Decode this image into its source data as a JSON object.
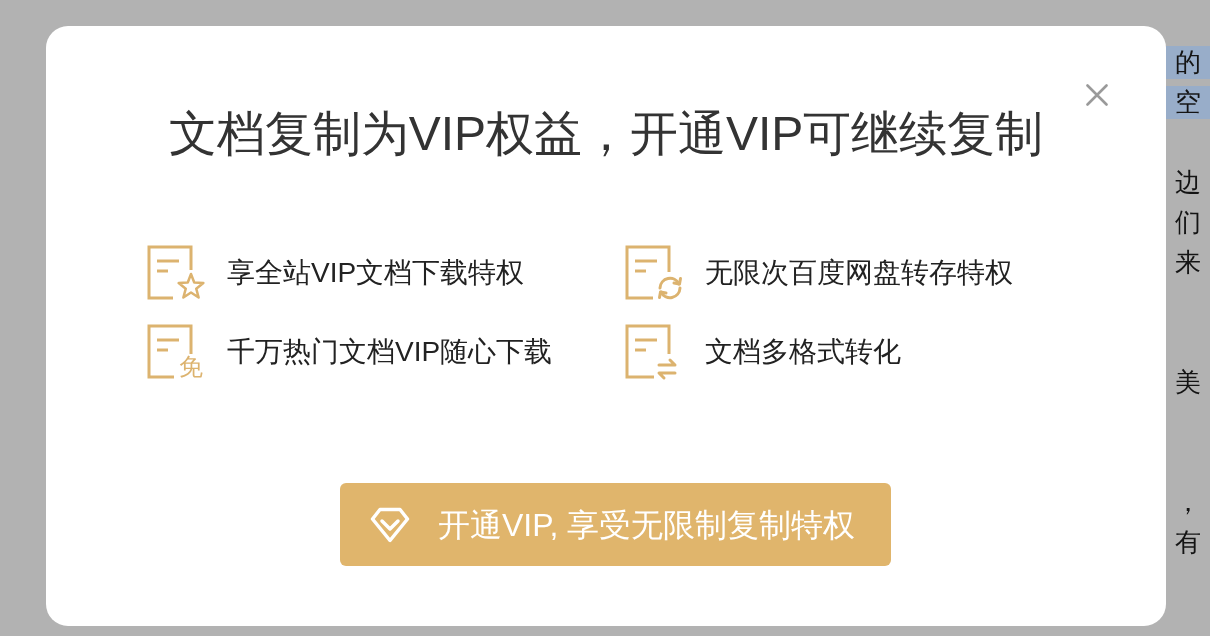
{
  "modal": {
    "title": "文档复制为VIP权益，开通VIP可继续复制",
    "benefits": [
      {
        "kind": "star",
        "label": "享全站VIP文档下载特权"
      },
      {
        "kind": "refresh",
        "label": "无限次百度网盘转存特权"
      },
      {
        "kind": "free",
        "badge": "免",
        "label": "千万热门文档VIP随心下载"
      },
      {
        "kind": "convert",
        "label": "文档多格式转化"
      }
    ],
    "cta_button": {
      "label": "开通VIP, 享受无限制复制特权"
    }
  },
  "background_document": {
    "lines": [
      {
        "text": "的",
        "highlighted": true
      },
      {
        "text": "空",
        "highlighted": true
      },
      {
        "text": "边",
        "highlighted": false
      },
      {
        "text": "们",
        "highlighted": false
      },
      {
        "text": "来",
        "highlighted": false
      },
      {
        "text": "美",
        "highlighted": false
      },
      {
        "text": "，",
        "highlighted": false
      },
      {
        "text": "有",
        "highlighted": false
      }
    ]
  }
}
